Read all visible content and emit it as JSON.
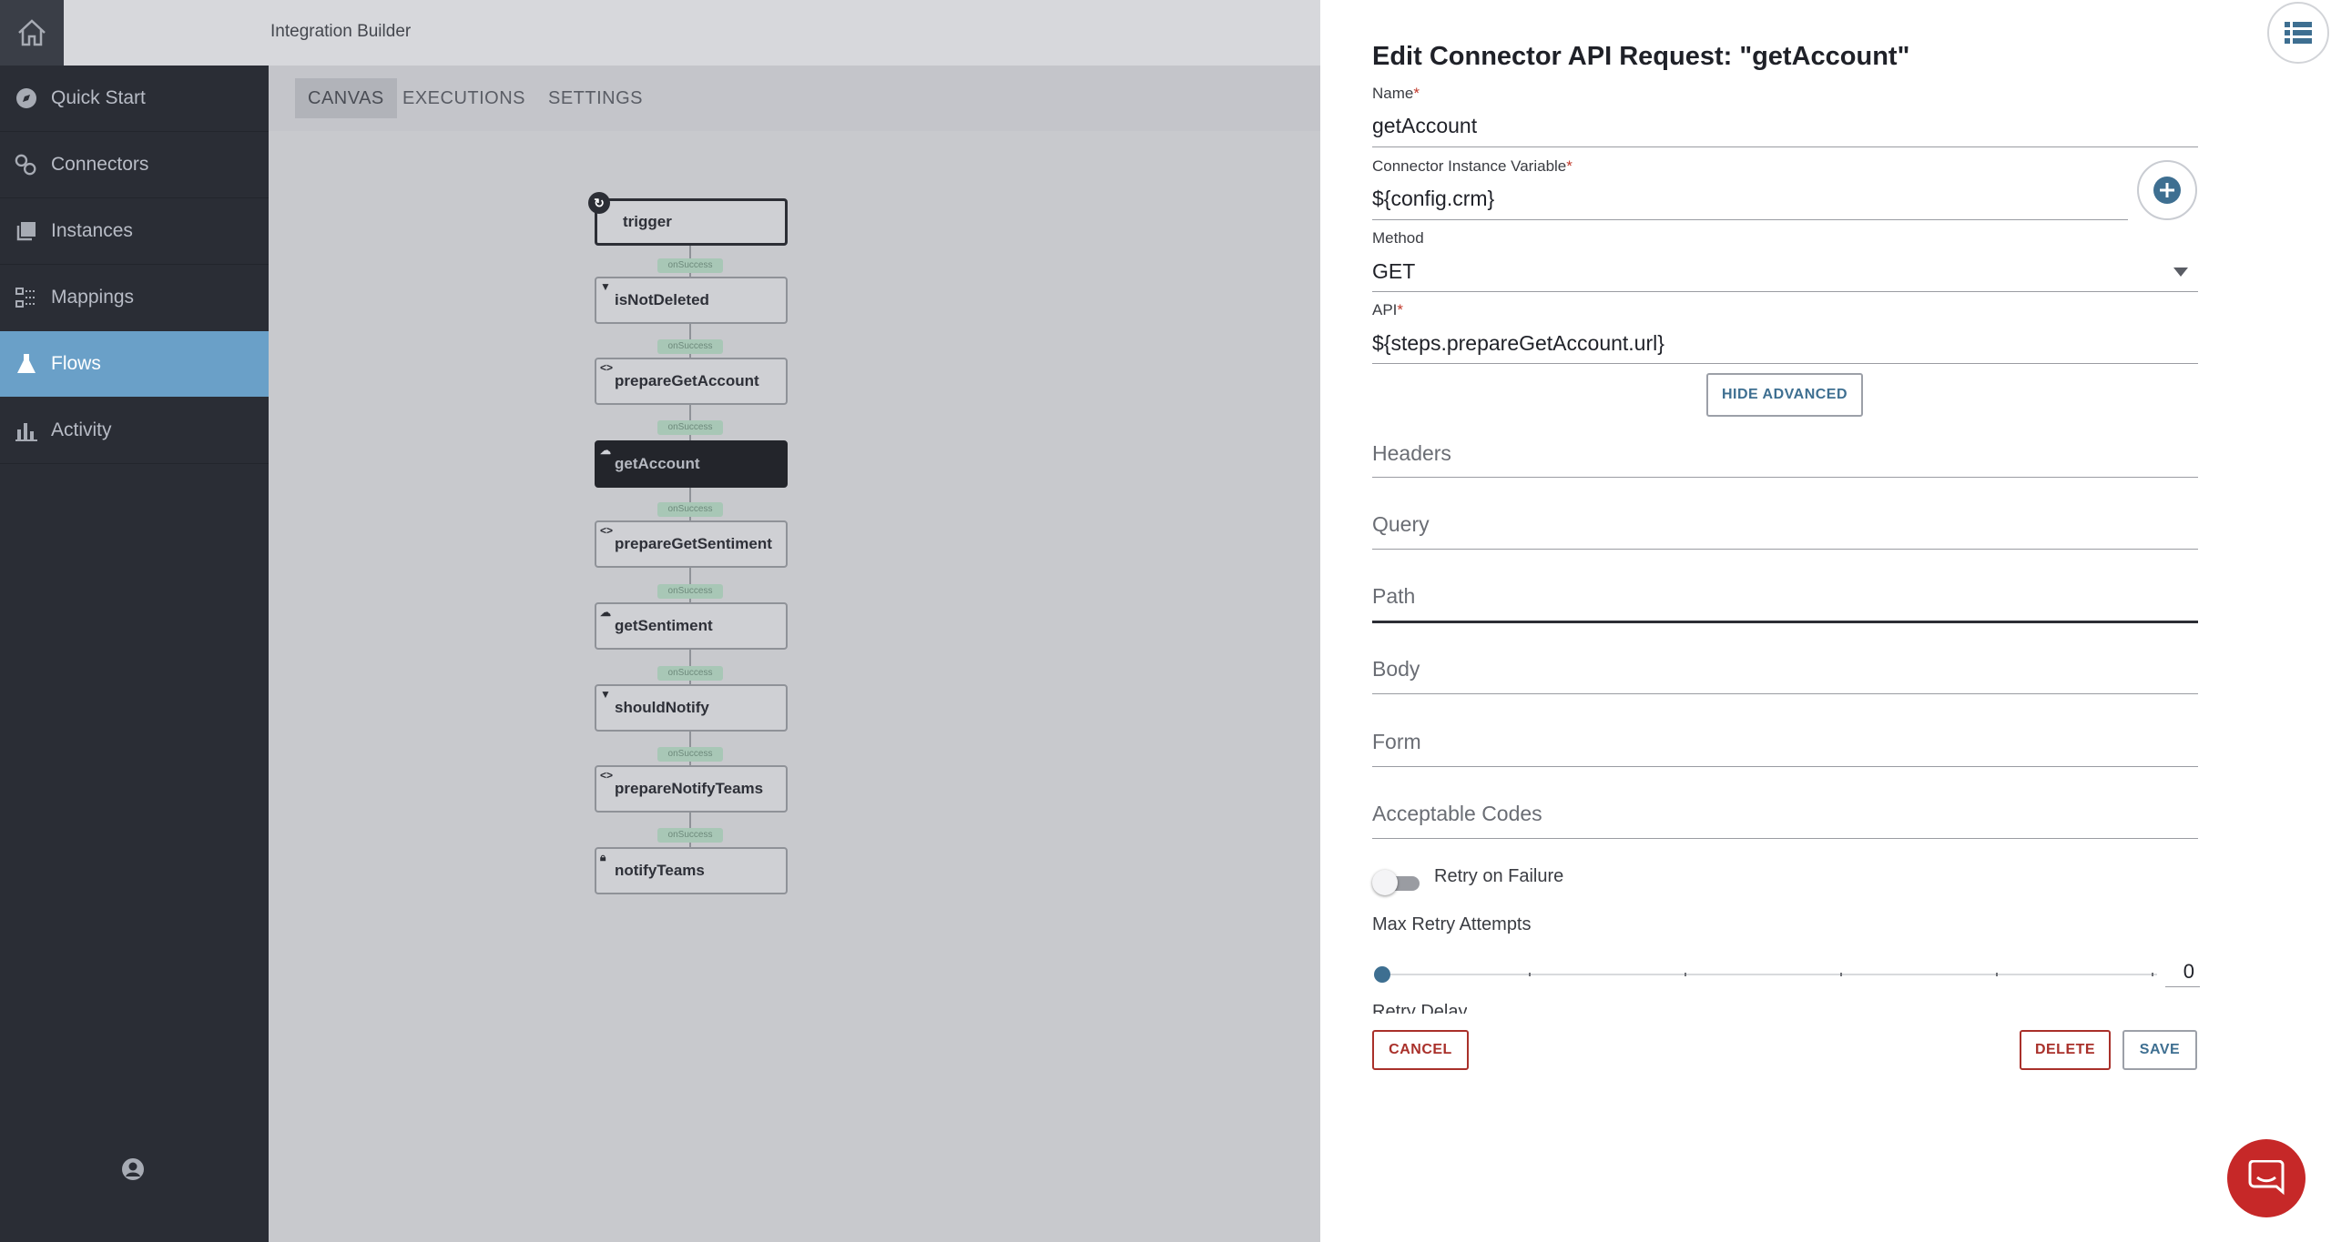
{
  "topbar": {
    "app_title": "Integration Builder"
  },
  "sidebar": {
    "items": [
      {
        "label": "Quick Start",
        "icon": "compass-icon"
      },
      {
        "label": "Connectors",
        "icon": "connectors-icon"
      },
      {
        "label": "Instances",
        "icon": "instances-icon"
      },
      {
        "label": "Mappings",
        "icon": "mappings-icon"
      },
      {
        "label": "Flows",
        "icon": "flask-icon",
        "active": true
      },
      {
        "label": "Activity",
        "icon": "bar-chart-icon"
      }
    ]
  },
  "subtabs": [
    {
      "label": "CANVAS",
      "active": true
    },
    {
      "label": "EXECUTIONS"
    },
    {
      "label": "SETTINGS"
    }
  ],
  "flow": {
    "nodes": [
      {
        "label": "trigger",
        "icon": "trigger-icon"
      },
      {
        "label": "isNotDeleted",
        "icon": "filter-icon"
      },
      {
        "label": "prepareGetAccount",
        "icon": "code-icon"
      },
      {
        "label": "getAccount",
        "icon": "cloud-icon",
        "selected": true
      },
      {
        "label": "prepareGetSentiment",
        "icon": "code-icon"
      },
      {
        "label": "getSentiment",
        "icon": "cloud-icon"
      },
      {
        "label": "shouldNotify",
        "icon": "filter-icon"
      },
      {
        "label": "prepareNotifyTeams",
        "icon": "code-icon"
      },
      {
        "label": "notifyTeams",
        "icon": "lock-icon"
      }
    ],
    "connector_label": "onSuccess"
  },
  "panel": {
    "title": "Edit Connector API Request: \"getAccount\"",
    "name_label": "Name",
    "name_value": "getAccount",
    "instance_var_label": "Connector Instance Variable",
    "instance_var_value": "${config.crm}",
    "method_label": "Method",
    "method_value": "GET",
    "api_label": "API",
    "api_value": "${steps.prepareGetAccount.url}",
    "hide_advanced": "HIDE ADVANCED",
    "sections": [
      "Headers",
      "Query",
      "Path",
      "Body",
      "Form",
      "Acceptable Codes"
    ],
    "retry_label": "Retry on Failure",
    "retry_enabled": false,
    "max_retry_label": "Max Retry Attempts",
    "max_retry_value": "0",
    "retry_delay_label": "Retry Delay",
    "cancel": "CANCEL",
    "delete": "DELETE",
    "save": "SAVE"
  },
  "colors": {
    "sidebar_bg": "#2a2d35",
    "active_nav": "#6aa0c8",
    "danger": "#a9302a",
    "accent": "#3e6f91",
    "chat": "#c62828"
  }
}
